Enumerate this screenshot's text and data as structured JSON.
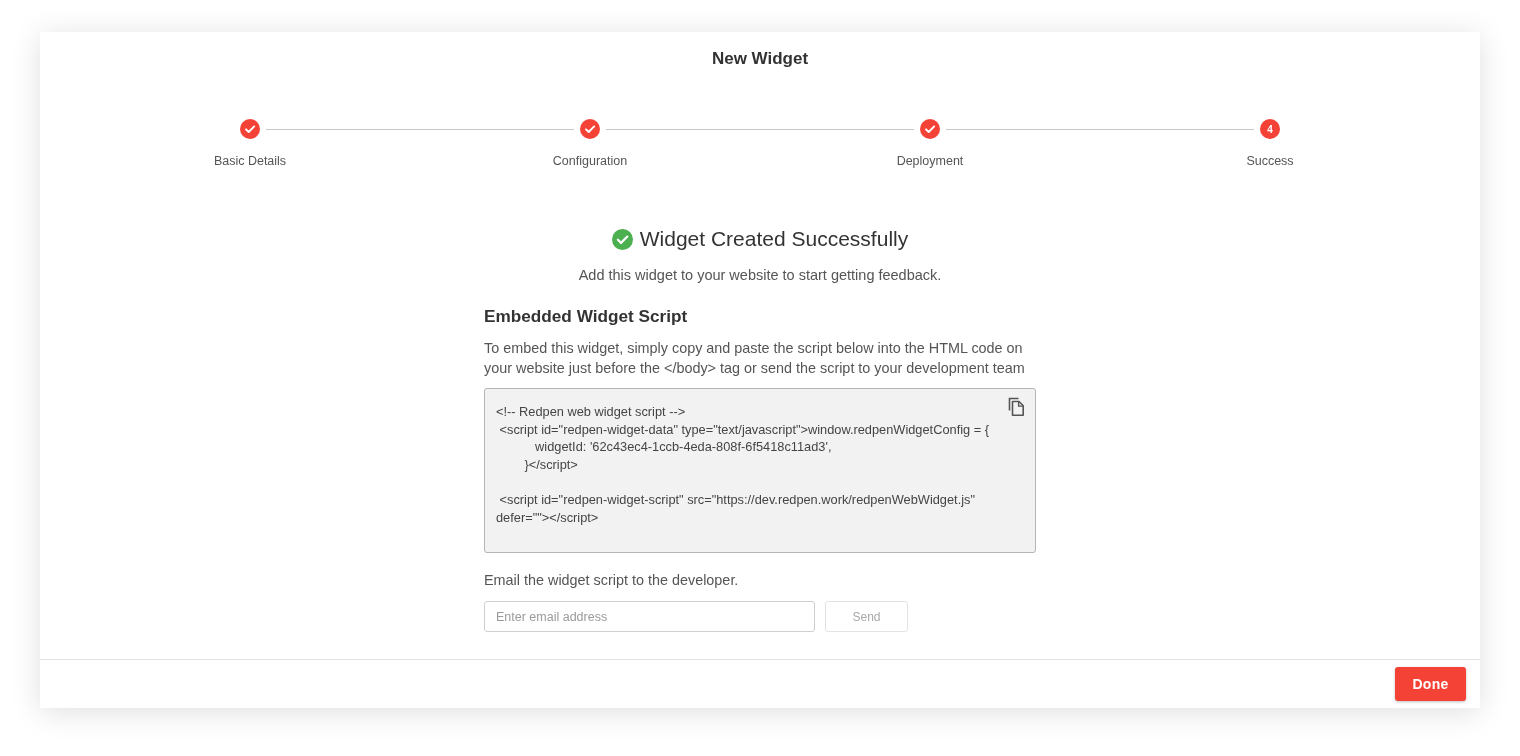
{
  "dialog": {
    "title": "New Widget"
  },
  "steps": [
    {
      "label": "Basic Details",
      "completed": true
    },
    {
      "label": "Configuration",
      "completed": true
    },
    {
      "label": "Deployment",
      "completed": true
    },
    {
      "label": "Success",
      "number": "4",
      "completed": false
    }
  ],
  "success": {
    "title": "Widget Created Successfully",
    "subtitle": "Add this widget to your website to start getting feedback."
  },
  "embed": {
    "heading": "Embedded Widget Script",
    "description": "To embed this widget, simply copy and paste the script below into the HTML code on your website just before the </body> tag or send the script to your development team",
    "code": "<!-- Redpen web widget script -->\n <script id=\"redpen-widget-data\" type=\"text/javascript\">window.redpenWidgetConfig = {\n           widgetId: '62c43ec4-1ccb-4eda-808f-6f5418c11ad3',\n        }</script>\n\n <script id=\"redpen-widget-script\" src=\"https://dev.redpen.work/redpenWebWidget.js\" defer=\"\"></script>"
  },
  "email": {
    "label": "Email the widget script to the developer.",
    "placeholder": "Enter email address",
    "send_button": {
      "label": "Send",
      "disabled": true
    }
  },
  "footer": {
    "done_button": "Done"
  }
}
